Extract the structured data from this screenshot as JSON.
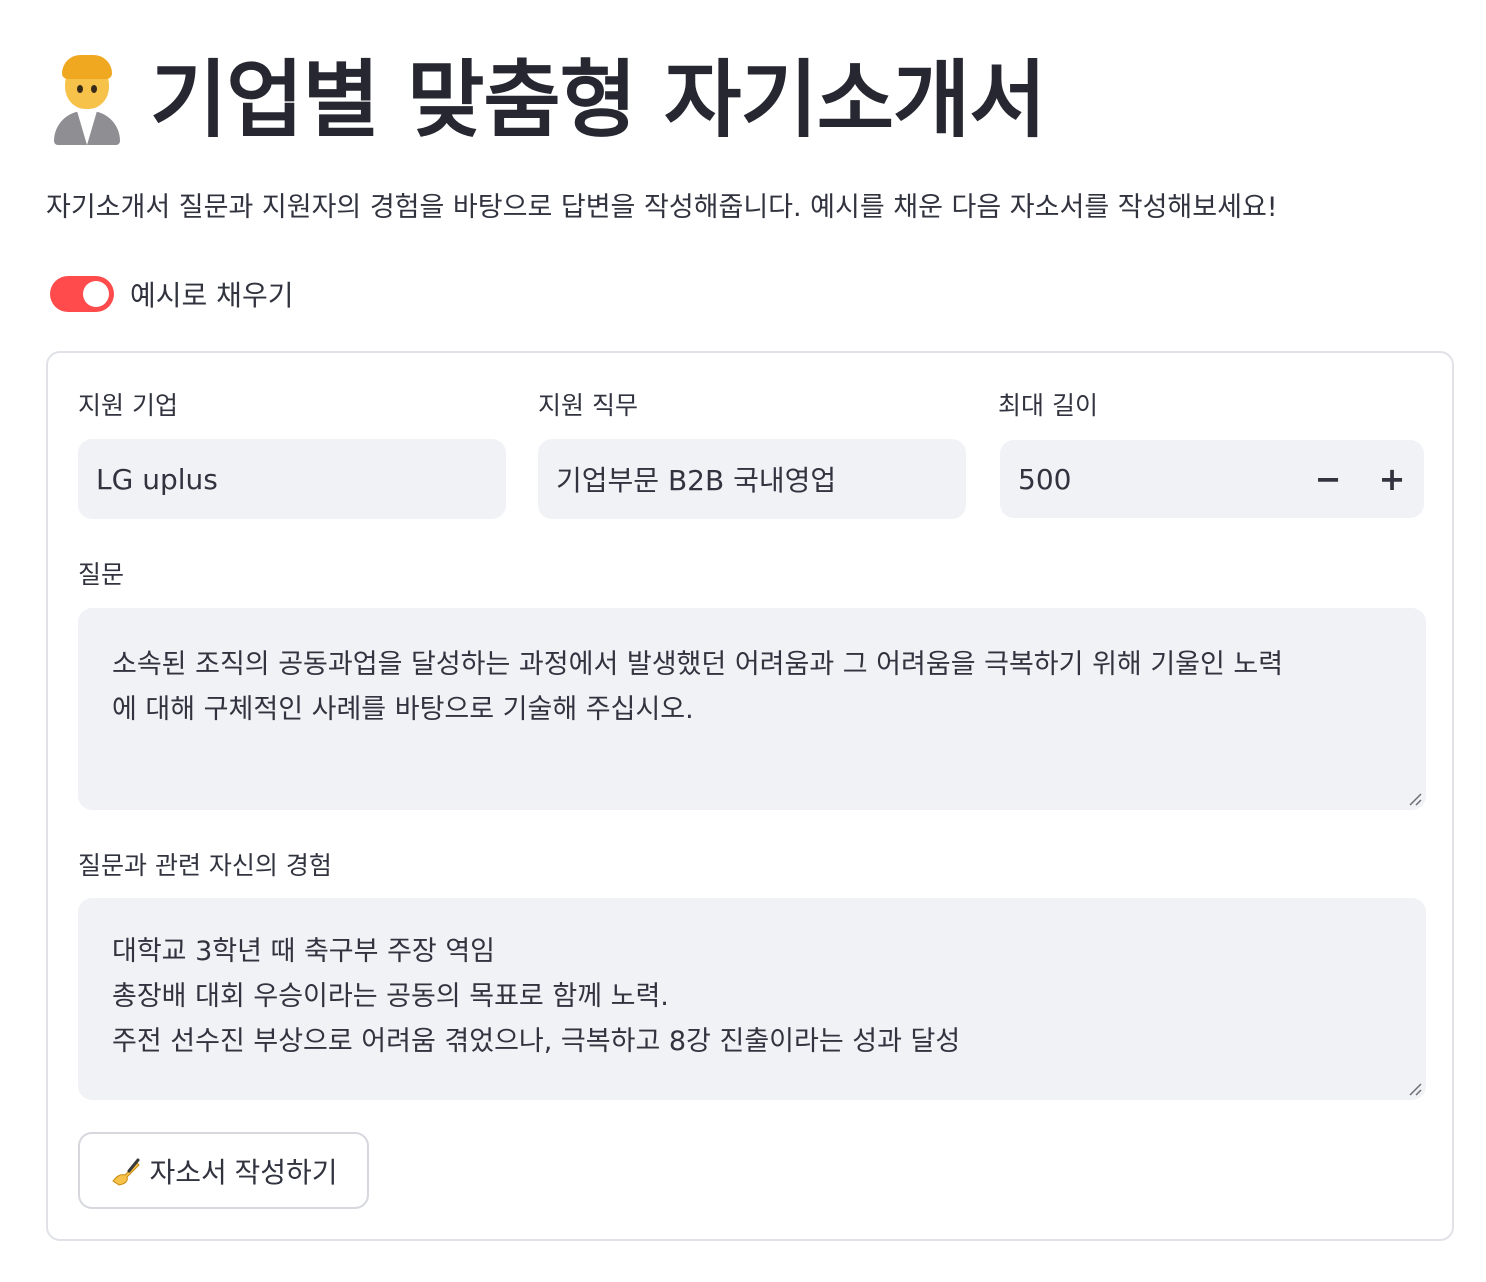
{
  "header": {
    "title": "기업별 맞춤형 자기소개서",
    "title_icon": "person-office-worker-emoji",
    "subtitle": "자기소개서 질문과 지원자의 경험을 바탕으로 답변을 작성해줍니다. 예시를 채운 다음 자소서를 작성해보세요!"
  },
  "toggle": {
    "label": "예시로 채우기",
    "checked": true,
    "color": "#ff4b4b"
  },
  "form": {
    "company": {
      "label": "지원 기업",
      "value": "LG uplus"
    },
    "position": {
      "label": "지원 직무",
      "value": "기업부문 B2B 국내영업"
    },
    "max_length": {
      "label": "최대 길이",
      "value": "500",
      "minus": "−",
      "plus": "+"
    },
    "question": {
      "label": "질문",
      "lines": [
        "소속된 조직의 공동과업을 달성하는 과정에서 발생했던 어려움과 그 어려움을 극복하기 위해 기울인 노력",
        "에 대해 구체적인 사례를 바탕으로 기술해 주십시오."
      ]
    },
    "experience": {
      "label": "질문과 관련 자신의 경험",
      "lines": [
        "대학교 3학년 때 축구부 주장 역임",
        "총장배 대회 우승이라는 공동의 목표로 함께 노력.",
        "주전 선수진 부상으로 어려움 겪었으나, 극복하고 8강 진출이라는 성과 달성"
      ]
    },
    "submit": {
      "icon": "writing-hand-emoji",
      "label": "자소서 작성하기"
    }
  }
}
